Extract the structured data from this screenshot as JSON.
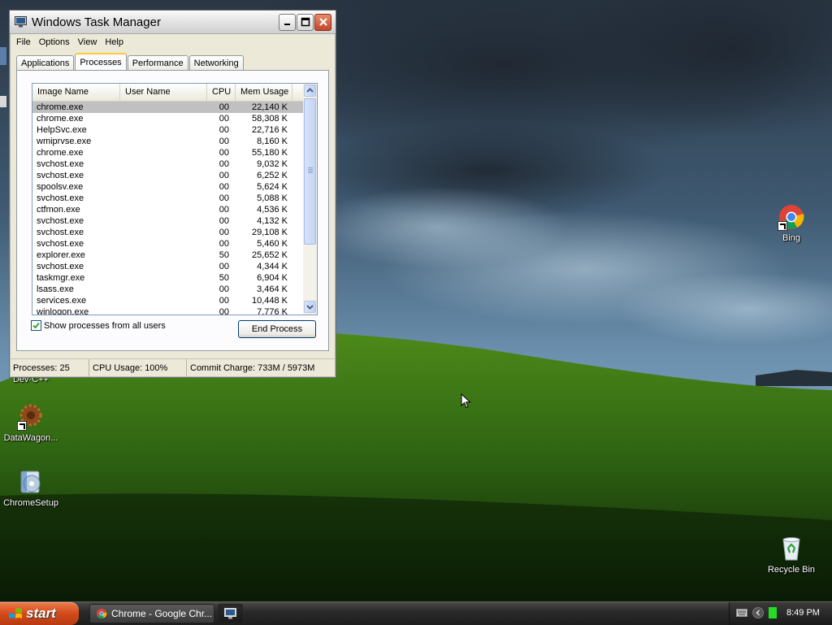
{
  "desktop": {
    "icons": [
      {
        "label": "Bing",
        "icon": "chrome-icon"
      },
      {
        "label": "Dev-C++",
        "icon": "dev-cpp-icon"
      },
      {
        "label": "DataWagon...",
        "icon": "datawagon-icon"
      },
      {
        "label": "ChromeSetup",
        "icon": "chrome-setup-icon"
      },
      {
        "label": "Recycle Bin",
        "icon": "recycle-bin-icon"
      }
    ]
  },
  "window": {
    "title": "Windows Task Manager",
    "menus": [
      "File",
      "Options",
      "View",
      "Help"
    ],
    "tabs": [
      "Applications",
      "Processes",
      "Performance",
      "Networking"
    ],
    "active_tab": "Processes",
    "columns": [
      "Image Name",
      "User Name",
      "CPU",
      "Mem Usage"
    ],
    "processes": [
      {
        "name": "chrome.exe",
        "user": "",
        "cpu": "00",
        "mem": "22,140 K"
      },
      {
        "name": "chrome.exe",
        "user": "",
        "cpu": "00",
        "mem": "58,308 K"
      },
      {
        "name": "HelpSvc.exe",
        "user": "",
        "cpu": "00",
        "mem": "22,716 K"
      },
      {
        "name": "wmiprvse.exe",
        "user": "",
        "cpu": "00",
        "mem": "8,160 K"
      },
      {
        "name": "chrome.exe",
        "user": "",
        "cpu": "00",
        "mem": "55,180 K"
      },
      {
        "name": "svchost.exe",
        "user": "",
        "cpu": "00",
        "mem": "9,032 K"
      },
      {
        "name": "svchost.exe",
        "user": "",
        "cpu": "00",
        "mem": "6,252 K"
      },
      {
        "name": "spoolsv.exe",
        "user": "",
        "cpu": "00",
        "mem": "5,624 K"
      },
      {
        "name": "svchost.exe",
        "user": "",
        "cpu": "00",
        "mem": "5,088 K"
      },
      {
        "name": "ctfmon.exe",
        "user": "",
        "cpu": "00",
        "mem": "4,536 K"
      },
      {
        "name": "svchost.exe",
        "user": "",
        "cpu": "00",
        "mem": "4,132 K"
      },
      {
        "name": "svchost.exe",
        "user": "",
        "cpu": "00",
        "mem": "29,108 K"
      },
      {
        "name": "svchost.exe",
        "user": "",
        "cpu": "00",
        "mem": "5,460 K"
      },
      {
        "name": "explorer.exe",
        "user": "",
        "cpu": "50",
        "mem": "25,652 K"
      },
      {
        "name": "svchost.exe",
        "user": "",
        "cpu": "00",
        "mem": "4,344 K"
      },
      {
        "name": "taskmgr.exe",
        "user": "",
        "cpu": "50",
        "mem": "6,904 K"
      },
      {
        "name": "lsass.exe",
        "user": "",
        "cpu": "00",
        "mem": "3,464 K"
      },
      {
        "name": "services.exe",
        "user": "",
        "cpu": "00",
        "mem": "10,448 K"
      },
      {
        "name": "winlogon.exe",
        "user": "",
        "cpu": "00",
        "mem": "7,776 K"
      }
    ],
    "selected_row": 0,
    "show_all_label": "Show processes from all users",
    "show_all_checked": true,
    "end_process_label": "End Process",
    "status": {
      "processes": "Processes: 25",
      "cpu": "CPU Usage: 100%",
      "commit": "Commit Charge: 733M / 5973M"
    }
  },
  "taskbar": {
    "start_label": "start",
    "tasks": [
      {
        "label": "Chrome - Google Chr...",
        "icon": "chrome-icon"
      },
      {
        "label": "",
        "icon": "task-manager-icon"
      }
    ],
    "clock": "8:49 PM"
  },
  "colors": {
    "start_button": "#d24a1a",
    "selected_row": "#c0c0c0",
    "tab_highlight": "#ffc83c",
    "tray_status": "#22dd22"
  }
}
